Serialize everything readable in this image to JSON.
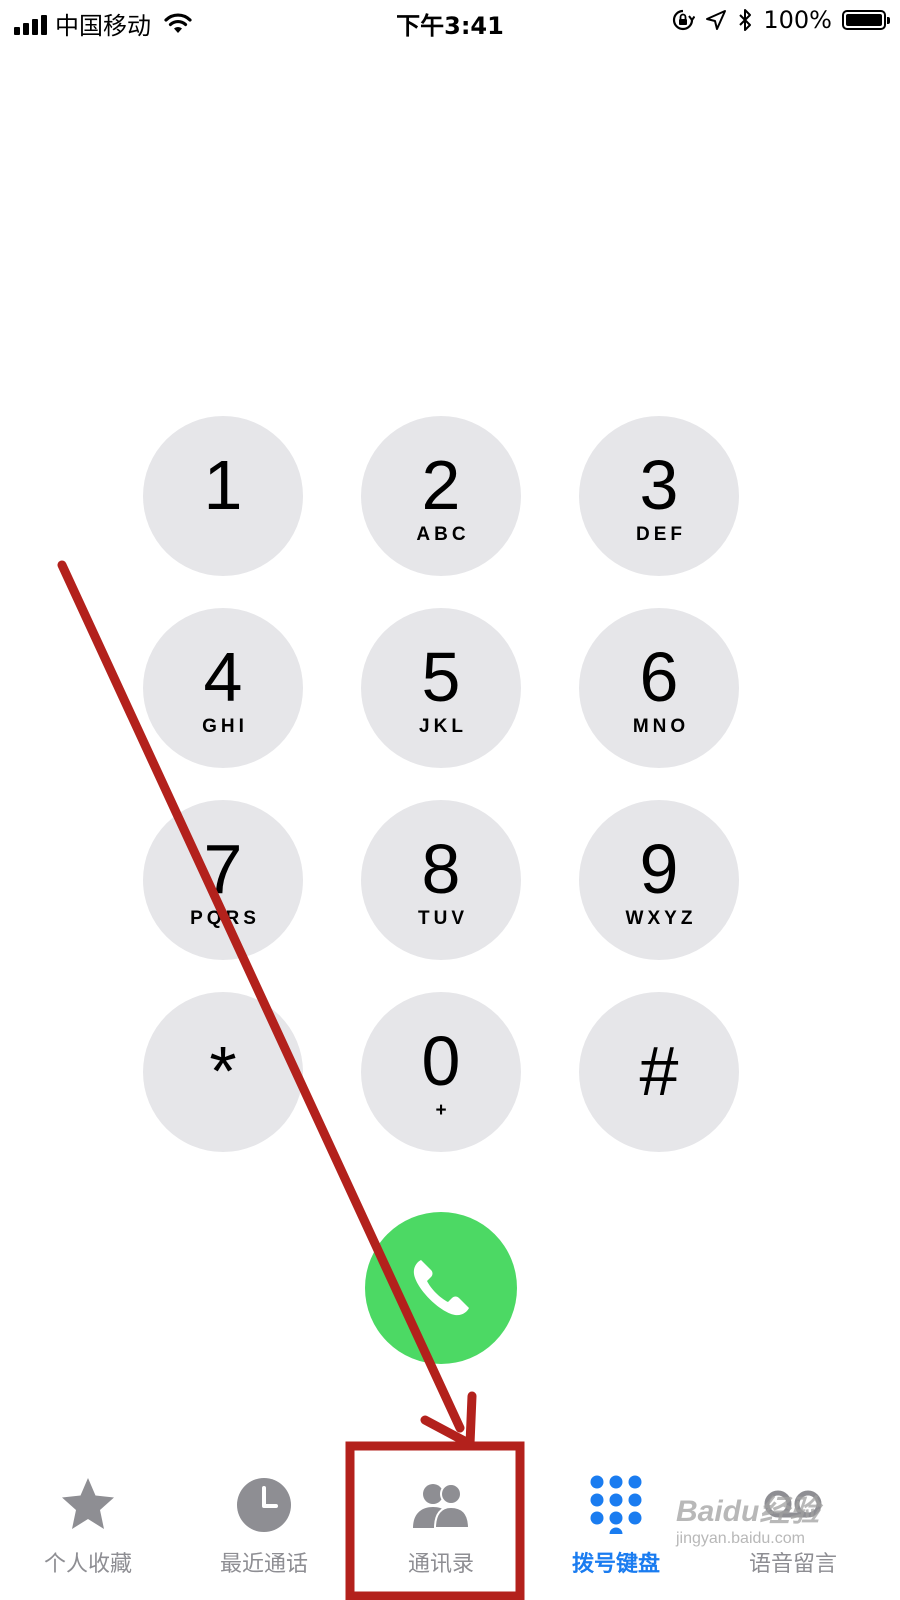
{
  "status_bar": {
    "carrier": "中国移动",
    "time": "下午3:41",
    "battery": "100%",
    "battery_level": 1.0
  },
  "keypad": {
    "keys": [
      {
        "digit": "1",
        "letters": ""
      },
      {
        "digit": "2",
        "letters": "ABC"
      },
      {
        "digit": "3",
        "letters": "DEF"
      },
      {
        "digit": "4",
        "letters": "GHI"
      },
      {
        "digit": "5",
        "letters": "JKL"
      },
      {
        "digit": "6",
        "letters": "MNO"
      },
      {
        "digit": "7",
        "letters": "PQRS"
      },
      {
        "digit": "8",
        "letters": "TUV"
      },
      {
        "digit": "9",
        "letters": "WXYZ"
      },
      {
        "digit": "*",
        "letters": ""
      },
      {
        "digit": "0",
        "letters": "+"
      },
      {
        "digit": "#",
        "letters": ""
      }
    ],
    "call_icon": "phone-icon",
    "call_color": "#4cd964",
    "key_color": "#e6e6e9"
  },
  "tab_bar": {
    "tabs": [
      {
        "label": "个人收藏",
        "icon": "star-icon"
      },
      {
        "label": "最近通话",
        "icon": "clock-icon"
      },
      {
        "label": "通讯录",
        "icon": "contacts-icon"
      },
      {
        "label": "拨号键盘",
        "icon": "keypad-icon"
      },
      {
        "label": "语音留言",
        "icon": "voicemail-icon"
      }
    ],
    "active_index": 3,
    "active_color": "#1a7cf0",
    "inactive_color": "#8e8e93"
  },
  "annotation": {
    "color": "#b3211c",
    "highlighted_tab": "通讯录"
  },
  "watermark": {
    "main": "Baidu经验",
    "sub": "jingyan.baidu.com"
  }
}
